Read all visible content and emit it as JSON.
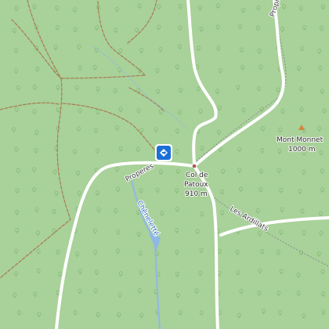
{
  "map": {
    "colors": {
      "forest": "#a9d19a",
      "road": "#ffffff",
      "track": "#a67c52",
      "water": "#8fb8e6",
      "peak": "#d4853a",
      "marker": "#1b6fd6"
    },
    "labels": {
      "road_properes": "Properes",
      "road_les_ardillats": "Les Ardillats",
      "road_top": "Propières",
      "stream": "Chêneletté",
      "col_name": "Col de",
      "col_name2": "Patoux",
      "col_elev": "910 m",
      "peak_name": "Mont Monnet",
      "peak_elev": "1000 m"
    },
    "icons": {
      "marker": "viewpoint-marker-icon",
      "peak": "peak-triangle-icon",
      "tree": "forest-tree-icon"
    }
  }
}
